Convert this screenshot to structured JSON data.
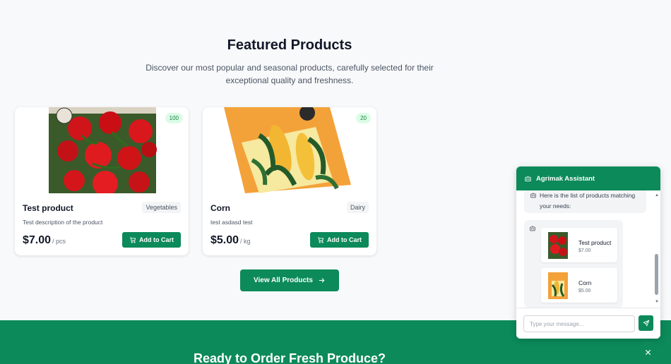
{
  "featured": {
    "title": "Featured Products",
    "subtitle": "Discover our most popular and seasonal products, carefully selected for their exceptional quality and freshness."
  },
  "products": [
    {
      "name": "Test product",
      "category": "Vegetables",
      "description": "Test description of the product",
      "price": "$7.00",
      "unit": "/ pcs",
      "stock": "100",
      "add_label": "Add to Cart",
      "image": "tomato-seed-packet"
    },
    {
      "name": "Corn",
      "category": "Dairy",
      "description": "test asdasd test",
      "price": "$5.00",
      "unit": "/ kg",
      "stock": "20",
      "add_label": "Add to Cart",
      "image": "corn-seed-packet"
    }
  ],
  "view_all_label": "View All Products",
  "cta": {
    "title": "Ready to Order Fresh Produce?"
  },
  "chat": {
    "title": "Agrimak Assistant",
    "bot_message": "Here is the list of products matching your needs:",
    "items": [
      {
        "name": "Test product",
        "price": "$7.00"
      },
      {
        "name": "Corn",
        "price": "$5.00"
      }
    ],
    "input_placeholder": "Type your message..."
  },
  "colors": {
    "brand_green": "#0c8a5a",
    "badge_green_bg": "#dcfce7"
  }
}
